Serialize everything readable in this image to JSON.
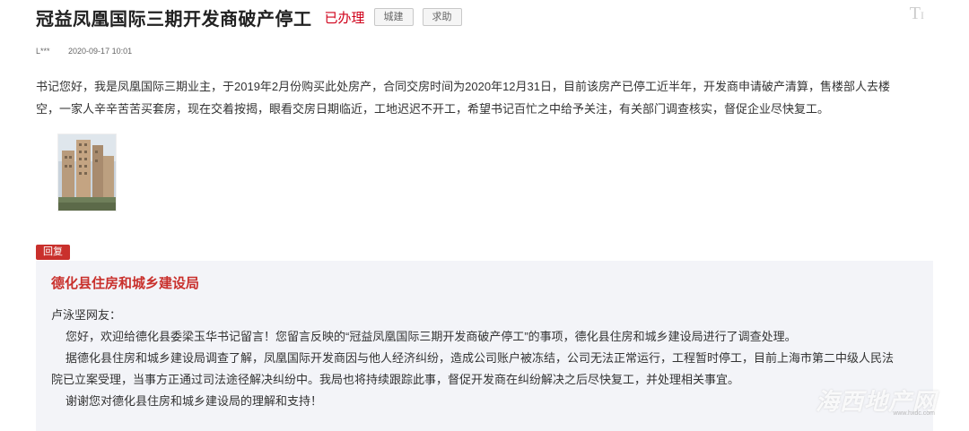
{
  "header": {
    "title": "冠益凤凰国际三期开发商破产停工",
    "status": "已办理",
    "tags": [
      "城建",
      "求助"
    ],
    "font_toggle": "T"
  },
  "meta": {
    "user": "L***",
    "datetime": "2020-09-17 10:01"
  },
  "message": {
    "lines": [
      "书记您好，我是凤凰国际三期业主，于2019年2月份购买此处房产，合同交房时间为2020年12月31日，目前该房产已停工近半年，开发商申请破产清算，售楼部人去楼",
      "空，一家人辛辛苦苦买套房，现在交着按揭，眼看交房日期临近，工地迟迟不开工，希望书记百忙之中给予关注，有关部门调查核实，督促企业尽快复工。"
    ]
  },
  "reply": {
    "badge": "回复",
    "department": "德化县住房和城乡建设局",
    "salutation": "卢泳坚网友：",
    "lines": [
      "您好，欢迎给德化县委梁玉华书记留言！您留言反映的“冠益凤凰国际三期开发商破产停工”的事项，德化县住房和城乡建设局进行了调查处理。",
      "据德化县住房和城乡建设局调查了解，凤凰国际开发商因与他人经济纠纷，造成公司账户被冻结，公司无法正常运行，工程暂时停工，目前上海市第二中级人民法",
      "院已立案受理，当事方正通过司法途径解决纠纷中。我局也将持续跟踪此事，督促开发商在纠纷解决之后尽快复工，并处理相关事宜。",
      "谢谢您对德化县住房和城乡建设局的理解和支持！"
    ]
  },
  "watermark": {
    "text": "海西地产网",
    "url": "www.hxdc.com"
  },
  "colors": {
    "accent_red": "#c9302c",
    "status_red": "#d0021b",
    "reply_bg": "#f3f4f8"
  }
}
